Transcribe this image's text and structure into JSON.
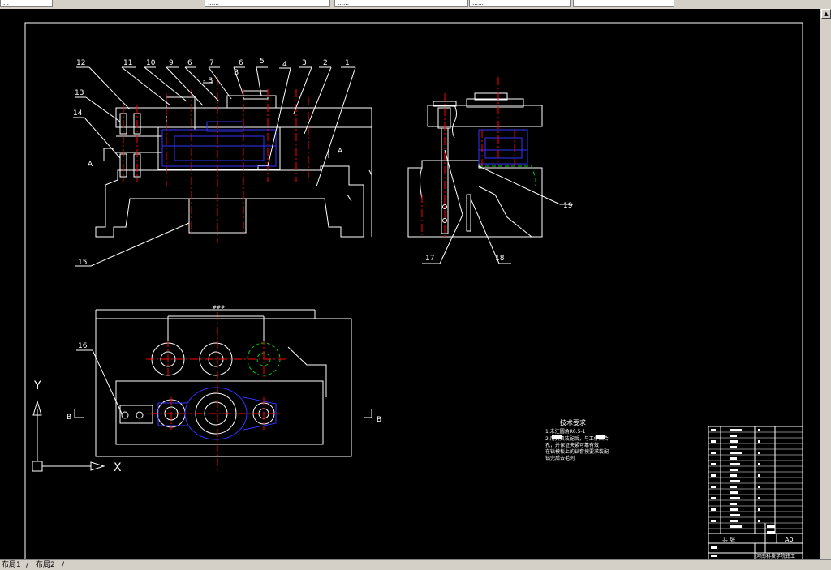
{
  "toolbar": {
    "fields": [
      {
        "name": "layer-combo",
        "text": "…"
      },
      {
        "name": "color-combo",
        "text": "……"
      },
      {
        "name": "linetype-combo",
        "text": "……"
      },
      {
        "name": "lineweight-combo",
        "text": "……"
      }
    ]
  },
  "drawing": {
    "front_view_balloons": [
      "12",
      "11",
      "10",
      "9",
      "6",
      "7",
      "6",
      "5",
      "4",
      "3",
      "2",
      "1",
      "13",
      "14",
      "15"
    ],
    "section_mark_a": "A",
    "section_mark_b": "B",
    "side_view_balloons": [
      "19",
      "17",
      "18"
    ],
    "top_view_balloon": "16",
    "dimension_top": "###",
    "section_label_top_view": "B",
    "section_label_front_view": "B",
    "axis_y": "Y",
    "axis_x": "X",
    "tech_req_title": "技术要求",
    "tech_req_lines": [
      "1.未注圆角R0.5-1",
      "2.用夹具装配后，与工件贴合",
      "孔，并保证夹紧可靠有效",
      "在钻模板上的钻套按要求装配",
      "钻完后去毛刺"
    ],
    "title_block": {
      "sheet_label": "共 张",
      "size_label": "A0",
      "school_label": "河南科技学院钳工"
    }
  },
  "tabs": {
    "labels": [
      "布局1",
      "布局2"
    ]
  },
  "colors": {
    "background": "#000000",
    "line_white": "#ffffff",
    "center_red": "#ff0000",
    "hidden_blue": "#3333ff",
    "green": "#00cc00",
    "chrome_gray": "#d4d0c8"
  }
}
